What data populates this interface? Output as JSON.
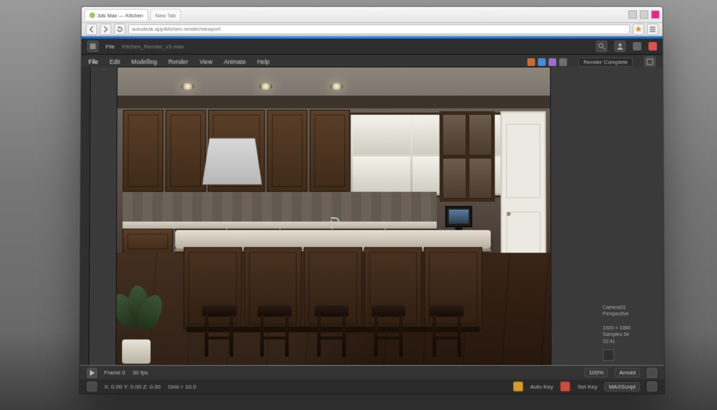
{
  "browser": {
    "tab1": "3ds Max — Kitchen",
    "tab2": "New Tab",
    "url": "autodesk.app/kitchen-render/viewport",
    "win_controls": {
      "min": "–",
      "max": "▢",
      "close": "✕"
    }
  },
  "appbar": {
    "file": "File",
    "title": "Kitchen_Render_v3.max"
  },
  "menu": {
    "items": [
      "File",
      "Edit",
      "Modelling",
      "Render",
      "View",
      "Animate",
      "Help"
    ],
    "status": "Render Complete",
    "right_tools": [
      "layers",
      "material",
      "snap",
      "settings"
    ]
  },
  "right_panel": {
    "line1": "Camera01",
    "line2": "Perspective",
    "res": "1920 × 1080",
    "samples": "Samples 64",
    "time": "02:41"
  },
  "footer1": {
    "frame": "Frame 0",
    "fps": "30 fps",
    "zoom": "100%",
    "renderer": "Arnold"
  },
  "footer2": {
    "coords": "X: 0.00  Y: 0.00  Z: 0.00",
    "grid": "Grid = 10.0",
    "autokey": "Auto Key",
    "set": "Set Key",
    "mem": "MAXScript"
  }
}
